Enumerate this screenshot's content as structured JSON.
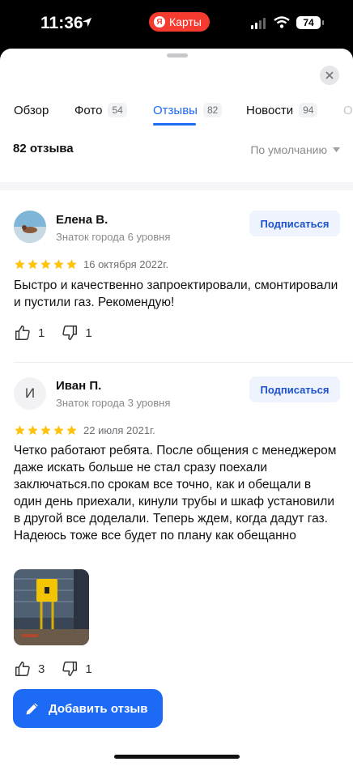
{
  "status_bar": {
    "time": "11:36",
    "app_pill": "Карты",
    "battery": "74"
  },
  "tabs": [
    {
      "label": "Обзор",
      "count": ""
    },
    {
      "label": "Фото",
      "count": "54"
    },
    {
      "label": "Отзывы",
      "count": "82",
      "active": true
    },
    {
      "label": "Новости",
      "count": "94"
    }
  ],
  "reviews_header": {
    "count_label": "82 отзыва",
    "sort_label": "По умолчанию"
  },
  "reviews": [
    {
      "author": "Елена В.",
      "rank": "Знаток города 6 уровня",
      "subscribe_label": "Подписаться",
      "stars": 5,
      "date": "16 октября 2022г.",
      "text": "Быстро и качественно запроектировали, смонтировали и пустили газ. Рекомендую!",
      "likes": "1",
      "dislikes": "1"
    },
    {
      "author": "Иван П.",
      "avatar_letter": "И",
      "rank": "Знаток города 3 уровня",
      "subscribe_label": "Подписаться",
      "stars": 5,
      "date": "22 июля 2021г.",
      "text": "Четко работают ребята. После общения с менеджером даже искать больше не стал сразу поехали заключаться.по срокам все точно, как и обещали в один день приехали, кинули трубы и шкаф установили в другой все доделали. Теперь ждем, когда дадут газ. Надеюсь тоже все будет по плану как обещанно",
      "likes": "3",
      "dislikes": "1"
    }
  ],
  "add_review_label": "Добавить отзыв",
  "colors": {
    "accent": "#1d6af5",
    "star": "#ffc20d",
    "maps_pill": "#f53b30"
  }
}
